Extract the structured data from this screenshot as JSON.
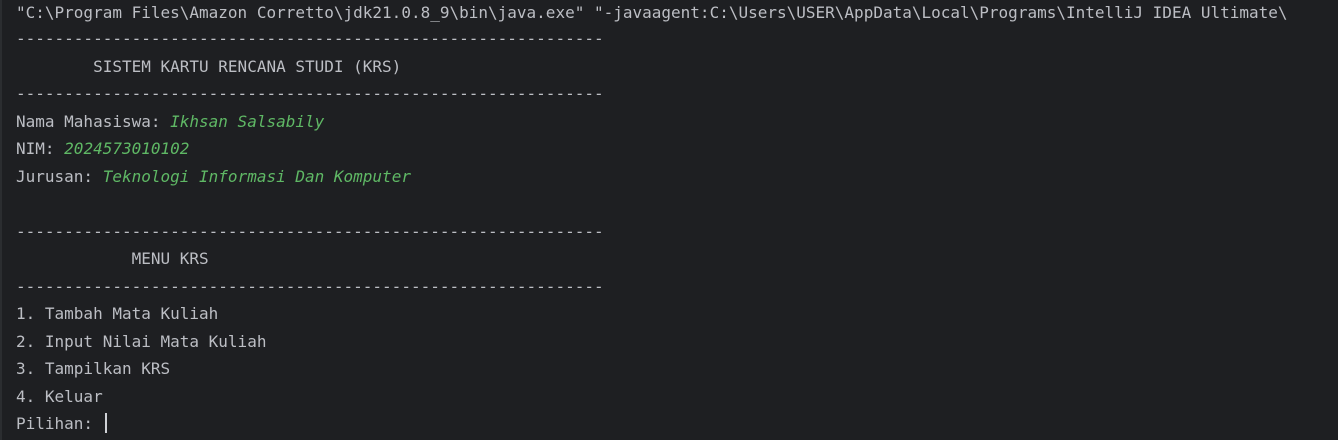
{
  "console": {
    "command": "\"C:\\Program Files\\Amazon Corretto\\jdk21.0.8_9\\bin\\java.exe\" \"-javaagent:C:\\Users\\USER\\AppData\\Local\\Programs\\IntelliJ IDEA Ultimate\\",
    "separator": "-------------------------------------------------------------",
    "title": "        SISTEM KARTU RENCANA STUDI (KRS)",
    "student": {
      "name_label": "Nama Mahasiswa: ",
      "name_value": "Ikhsan Salsabily",
      "nim_label": "NIM: ",
      "nim_value": "2024573010102",
      "major_label": "Jurusan: ",
      "major_value": "Teknologi Informasi Dan Komputer"
    },
    "menu_title": "            MENU KRS",
    "menu_items": [
      "1. Tambah Mata Kuliah",
      "2. Input Nilai Mata Kuliah",
      "3. Tampilkan KRS",
      "4. Keluar"
    ],
    "prompt": "Pilihan: "
  }
}
